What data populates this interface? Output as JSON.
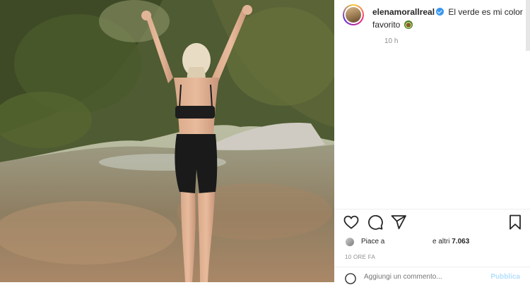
{
  "post": {
    "username": "elenamorallreal",
    "caption": "El verde es mi color favorito",
    "time_ago": "10 h",
    "likes_prefix": "Piace a",
    "likes_suffix": "e altri",
    "likes_count": "7.063",
    "timestamp": "10 ORE FA",
    "comment_placeholder": "Aggiungi un commento...",
    "publish_label": "Pubblica"
  },
  "icons": [
    "heart-icon",
    "comment-icon",
    "share-icon",
    "bookmark-icon",
    "emoji-smile-icon",
    "verified-badge-icon"
  ],
  "colors": {
    "verified": "#3897f0",
    "text": "#262626",
    "muted": "#8e8e8e",
    "publish": "#b2dffc"
  }
}
